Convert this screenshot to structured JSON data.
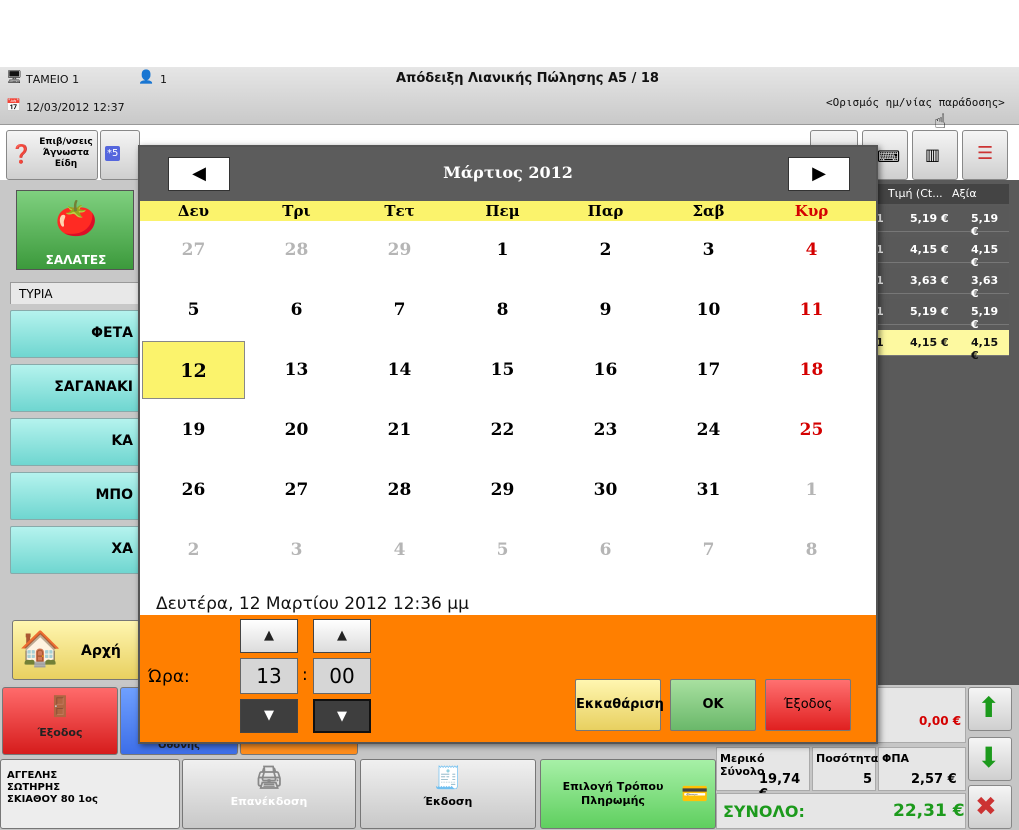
{
  "window": {
    "register": "ΤΑΜΕΙΟ 1",
    "user_count": "1",
    "datetime": "12/03/2012 12:37",
    "title": "Απόδειξη Λιανικής Πώλησης  Α5 / 18",
    "delivery_link": "<Ορισμός ημ/νίας παράδοσης>"
  },
  "toolbar": {
    "unknown_items": "Επιβ/νσεις Άγνωστα Είδη",
    "badge": "*5"
  },
  "left": {
    "category": "ΣΑΛΑΤΕΣ",
    "tab": "ΤΥΡΙΑ",
    "items": [
      "ΦΕΤΑ",
      "ΣΑΓΑΝΑΚΙ",
      "ΚΑ",
      "ΜΠΟ",
      "ΧΑ"
    ],
    "home": "Αρχή"
  },
  "right": {
    "col_price": "Τιμή (Ct...",
    "col_value": "Αξία",
    "rows": [
      {
        "q": "1",
        "p": "5,19 €",
        "v": "5,19 €"
      },
      {
        "q": "1",
        "p": "4,15 €",
        "v": "4,15 €"
      },
      {
        "q": "1",
        "p": "3,63 €",
        "v": "3,63 €"
      },
      {
        "q": "1",
        "p": "5,19 €",
        "v": "5,19 €"
      },
      {
        "q": "1",
        "p": "4,15 €",
        "v": "4,15 €"
      }
    ]
  },
  "calendar": {
    "month": "Μάρτιος 2012",
    "prev": "◀",
    "next": "▶",
    "days_of_week": [
      "Δευ",
      "Τρι",
      "Τετ",
      "Πεμ",
      "Παρ",
      "Σαβ",
      "Κυρ"
    ],
    "weeks": [
      [
        "27",
        "28",
        "29",
        "1",
        "2",
        "3",
        "4"
      ],
      [
        "5",
        "6",
        "7",
        "8",
        "9",
        "10",
        "11"
      ],
      [
        "12",
        "13",
        "14",
        "15",
        "16",
        "17",
        "18"
      ],
      [
        "19",
        "20",
        "21",
        "22",
        "23",
        "24",
        "25"
      ],
      [
        "26",
        "27",
        "28",
        "29",
        "30",
        "31",
        "1"
      ],
      [
        "2",
        "3",
        "4",
        "5",
        "6",
        "7",
        "8"
      ]
    ],
    "selected": "12",
    "long_date": "Δευτέρα, 12 Μαρτίου 2012 12:36 μμ"
  },
  "time": {
    "label": "Ώρα:",
    "hour": "13",
    "minute": "00",
    "sep": ":",
    "up": "▲",
    "down": "▼"
  },
  "actions": {
    "clear": "Εκκαθάριση",
    "ok": "ΟΚ",
    "exit": "Έξοδος"
  },
  "bottom": {
    "exit": "Έξοδος",
    "screen": "Οθόνης",
    "customer": [
      "ΑΓΓΕΛΗΣ",
      "ΣΩΤΗΡΗΣ",
      "ΣΚΙΑΘΟΥ 80   1ος"
    ],
    "reissue": "Επανέκδοση",
    "issue": "Έκδοση",
    "payment": "Επιλογή Τρόπου Πληρωμής",
    "discount": "0,00 €",
    "subtotal_label": "Μερικό Σύνολο",
    "subtotal": "19,74 €",
    "qty_label": "Ποσότητα",
    "qty": "5",
    "vat_label": "ΦΠΑ",
    "vat": "2,57 €",
    "total_label": "ΣΥΝΟΛΟ:",
    "total": "22,31 €"
  },
  "colors": {
    "accent": "#ff7f00",
    "highlight": "#fbf36c",
    "sunday": "#d40000",
    "teal": "#6fd6d0"
  }
}
